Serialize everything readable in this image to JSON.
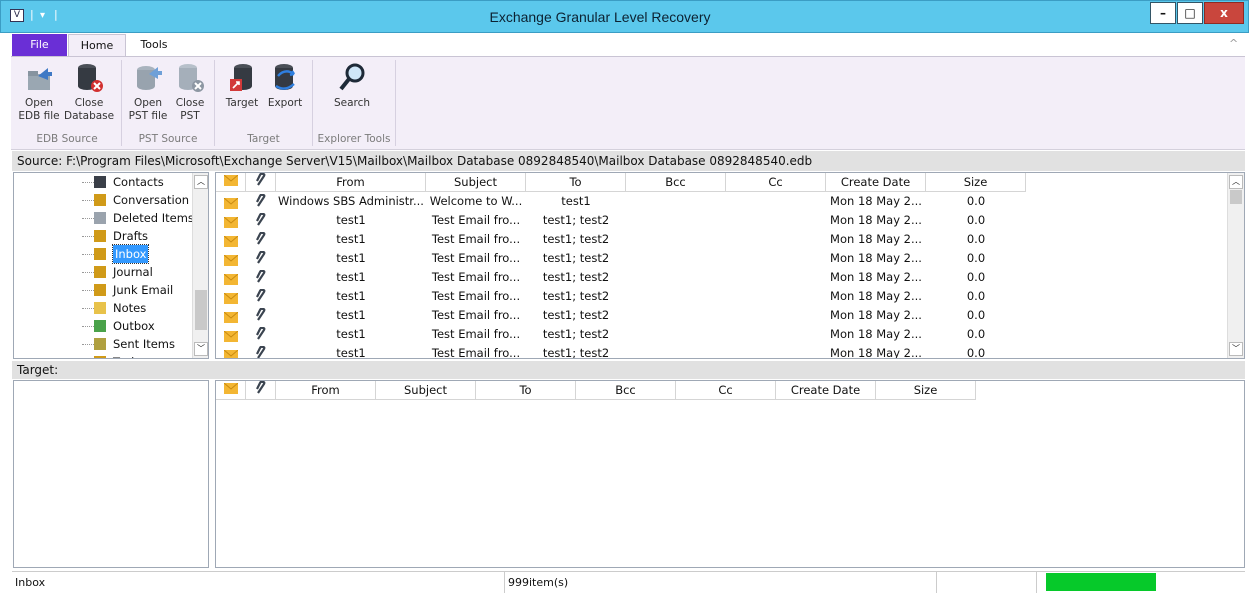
{
  "window": {
    "title": "Exchange Granular Level Recovery",
    "qa_sep": "|",
    "qa_down": "⨡",
    "minimize": "–",
    "maximize": "□",
    "close": "x"
  },
  "ribbon_tabs": {
    "file": "File",
    "home": "Home",
    "tools": "Tools"
  },
  "ribbon": {
    "open_edb": [
      "Open",
      "EDB file"
    ],
    "close_db": [
      "Close",
      "Database"
    ],
    "open_pst": [
      "Open",
      "PST file"
    ],
    "close_pst": [
      "Close",
      "PST"
    ],
    "target": "Target",
    "export": "Export",
    "search": "Search",
    "groups": {
      "edb": "EDB Source",
      "pst": "PST Source",
      "target": "Target",
      "explorer": "Explorer Tools"
    },
    "collapse": "^"
  },
  "source": {
    "label": "Source: F:\\Program Files\\Microsoft\\Exchange Server\\V15\\Mailbox\\Mailbox Database 0892848540\\Mailbox Database 0892848540.edb"
  },
  "tree": [
    "Contacts",
    "Conversation A",
    "Deleted Items",
    "Drafts",
    "Inbox",
    "Journal",
    "Junk Email",
    "Notes",
    "Outbox",
    "Sent Items",
    "Tasks"
  ],
  "grid": {
    "columns": [
      "From",
      "Subject",
      "To",
      "Bcc",
      "Cc",
      "Create Date",
      "Size"
    ],
    "rows": [
      {
        "from": "Windows SBS Administr...",
        "subject": "Welcome to W...",
        "to": "test1",
        "bcc": "",
        "cc": "",
        "date": "Mon 18 May 2...",
        "size": "0.0"
      },
      {
        "from": "test1",
        "subject": "Test Email fro...",
        "to": "test1; test2",
        "bcc": "",
        "cc": "",
        "date": "Mon 18 May 2...",
        "size": "0.0"
      },
      {
        "from": "test1",
        "subject": "Test Email fro...",
        "to": "test1; test2",
        "bcc": "",
        "cc": "",
        "date": "Mon 18 May 2...",
        "size": "0.0"
      },
      {
        "from": "test1",
        "subject": "Test Email fro...",
        "to": "test1; test2",
        "bcc": "",
        "cc": "",
        "date": "Mon 18 May 2...",
        "size": "0.0"
      },
      {
        "from": "test1",
        "subject": "Test Email fro...",
        "to": "test1; test2",
        "bcc": "",
        "cc": "",
        "date": "Mon 18 May 2...",
        "size": "0.0"
      },
      {
        "from": "test1",
        "subject": "Test Email fro...",
        "to": "test1; test2",
        "bcc": "",
        "cc": "",
        "date": "Mon 18 May 2...",
        "size": "0.0"
      },
      {
        "from": "test1",
        "subject": "Test Email fro...",
        "to": "test1; test2",
        "bcc": "",
        "cc": "",
        "date": "Mon 18 May 2...",
        "size": "0.0"
      },
      {
        "from": "test1",
        "subject": "Test Email fro...",
        "to": "test1; test2",
        "bcc": "",
        "cc": "",
        "date": "Mon 18 May 2...",
        "size": "0.0"
      },
      {
        "from": "test1",
        "subject": "Test Email fro...",
        "to": "test1; test2",
        "bcc": "",
        "cc": "",
        "date": "Mon 18 May 2...",
        "size": "0.0"
      }
    ]
  },
  "target": {
    "label": "Target:",
    "columns": [
      "From",
      "Subject",
      "To",
      "Bcc",
      "Cc",
      "Create Date",
      "Size"
    ]
  },
  "status": {
    "folder": "Inbox",
    "count": "999item(s)",
    "progress": 1.0
  },
  "colors": {
    "accent": "#5bc8ec",
    "file_tab": "#6a2fd6",
    "progress": "#06c92a",
    "envelope": "#f3b633"
  }
}
